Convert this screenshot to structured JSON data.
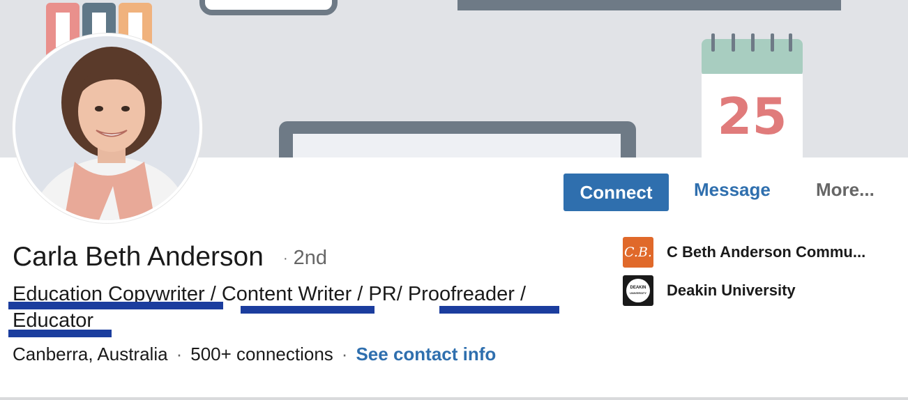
{
  "banner": {
    "calendar_date": "25"
  },
  "actions": {
    "connect_label": "Connect",
    "message_label": "Message",
    "more_label": "More..."
  },
  "profile": {
    "name": "Carla Beth Anderson",
    "degree": "2nd",
    "headline_line1": [
      "Education Copywriter",
      " / ",
      "Content Writer",
      " / PR/ ",
      "Proofreader",
      " /"
    ],
    "headline_line2": "Educator",
    "location": "Canberra, Australia",
    "connections": "500+ connections",
    "contact_link": "See contact info"
  },
  "organizations": [
    {
      "name": "C Beth Anderson Commu...",
      "logo_text": "C.B.",
      "logo_color": "#e0692a"
    },
    {
      "name": "Deakin University",
      "logo_text": "DEAKIN",
      "logo_sub": "UNIVERSITY",
      "logo_color": "#1a1a1a"
    }
  ],
  "colors": {
    "accent": "#2f6fae",
    "annotation_underline": "#1b3d9e",
    "banner_bg": "#e1e3e7"
  }
}
